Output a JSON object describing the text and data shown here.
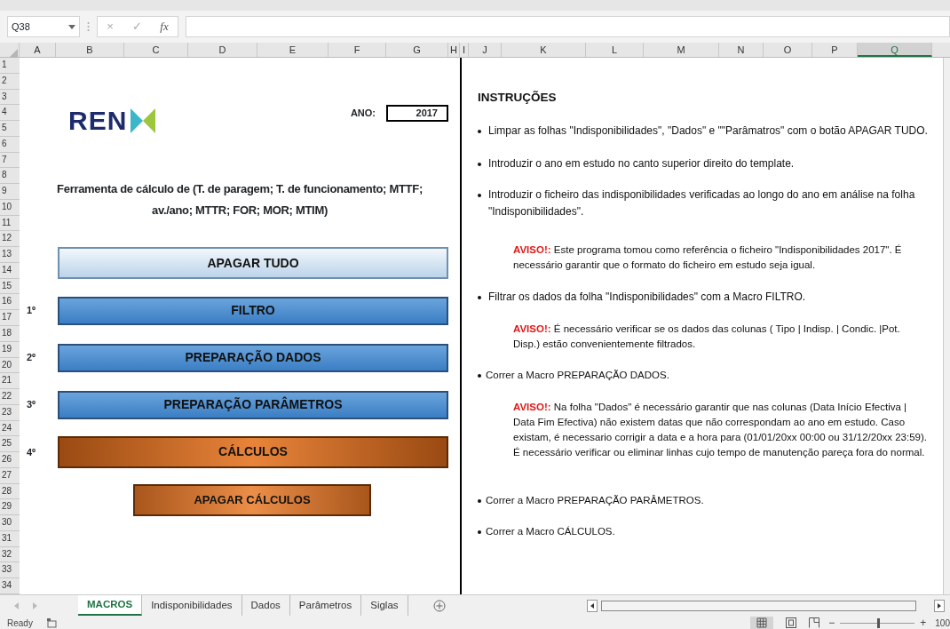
{
  "formula_bar": {
    "name_box": "Q38",
    "cancel": "×",
    "enter": "✓",
    "function_label": "fx"
  },
  "columns": [
    {
      "label": "A",
      "selected": false
    },
    {
      "label": "B",
      "selected": false
    },
    {
      "label": "C",
      "selected": false
    },
    {
      "label": "D",
      "selected": false
    },
    {
      "label": "E",
      "selected": false
    },
    {
      "label": "F",
      "selected": false
    },
    {
      "label": "G",
      "selected": false
    },
    {
      "label": "H",
      "selected": false
    },
    {
      "label": "I",
      "selected": false
    },
    {
      "label": "J",
      "selected": false
    },
    {
      "label": "K",
      "selected": false
    },
    {
      "label": "L",
      "selected": false
    },
    {
      "label": "M",
      "selected": false
    },
    {
      "label": "N",
      "selected": false
    },
    {
      "label": "O",
      "selected": false
    },
    {
      "label": "P",
      "selected": false
    },
    {
      "label": "Q",
      "selected": true
    }
  ],
  "rows": [
    "1",
    "2",
    "3",
    "4",
    "5",
    "6",
    "7",
    "8",
    "9",
    "10",
    "11",
    "12",
    "13",
    "14",
    "15",
    "16",
    "17",
    "18",
    "19",
    "20",
    "21",
    "22",
    "23",
    "24",
    "25",
    "26",
    "27",
    "28",
    "29",
    "30",
    "31",
    "32",
    "33",
    "34"
  ],
  "macros_panel": {
    "logo_text": "REN",
    "year_label": "ANO:",
    "year": "2017",
    "title": "Ferramenta de cálculo de (T. de paragem; T. de funcionamento; MTTF; av./ano; MTTR; FOR; MOR; MTIM)",
    "buttons": [
      {
        "label": "APAGAR TUDO",
        "kind": "light"
      },
      {
        "label": "FILTRO",
        "kind": "blue",
        "step": "1º"
      },
      {
        "label": "PREPARAÇÃO DADOS",
        "kind": "blue",
        "step": "2º"
      },
      {
        "label": "PREPARAÇÃO PARÂMETROS",
        "kind": "blue",
        "step": "3º"
      },
      {
        "label": "CÁLCULOS",
        "kind": "orange",
        "step": "4º"
      },
      {
        "label": "APAGAR CÁLCULOS",
        "kind": "orange_small"
      }
    ]
  },
  "instructions": {
    "heading": "INSTRUÇÕES",
    "items": [
      {
        "kind": "bullet",
        "text": "Limpar as folhas \"Indisponibilidades\", \"Dados\" e \"\"Parâmatros\" com o botão APAGAR TUDO."
      },
      {
        "kind": "bullet",
        "text": "Introduzir o ano em estudo no canto superior direito do template."
      },
      {
        "kind": "bullet",
        "text": "Introduzir o ficheiro das indisponibilidades verificadas ao longo do ano em análise na folha \"Indisponibilidades\"."
      },
      {
        "kind": "warning",
        "prefix": "AVISO!:",
        "text": "Este programa tomou como referência o ficheiro \"Indisponibilidades 2017\". É necessário garantir que o formato do ficheiro em estudo seja igual."
      },
      {
        "kind": "bullet",
        "text": "Filtrar os dados da folha \"Indisponibilidades\" com a Macro FILTRO."
      },
      {
        "kind": "warning",
        "prefix": "AVISO!:",
        "text": "É necessário verificar se os dados das colunas ( Tipo | Indisp. | Condic. |Pot. Disp.) estão convenientemente filtrados."
      },
      {
        "kind": "bullet_small",
        "text": "Correr a Macro PREPARAÇÃO DADOS."
      },
      {
        "kind": "warning",
        "prefix": "AVISO!:",
        "text": "Na folha \"Dados\" é necessário garantir que nas colunas (Data Início Efectiva | Data Fim Efectiva) não existem datas que não correspondam ao ano em estudo. Caso existam, é necessario corrigir a data e a hora para (01/01/20xx 00:00 ou 31/12/20xx 23:59). É necessário verificar ou eliminar linhas cujo tempo de manutenção pareça fora do normal."
      },
      {
        "kind": "bullet_small",
        "text": "Correr a Macro PREPARAÇÃO PARÂMETROS."
      },
      {
        "kind": "bullet_small",
        "text": "Correr a Macro CÁLCULOS."
      }
    ]
  },
  "sheet_tabs": [
    {
      "label": "MACROS",
      "selected": true
    },
    {
      "label": "Indisponibilidades",
      "selected": false
    },
    {
      "label": "Dados",
      "selected": false
    },
    {
      "label": "Parâmetros",
      "selected": false
    },
    {
      "label": "Siglas",
      "selected": false
    }
  ],
  "status_bar": {
    "status": "Ready",
    "zoom": {
      "minus": "−",
      "plus": "+",
      "level": 0.5,
      "label": "100"
    }
  }
}
